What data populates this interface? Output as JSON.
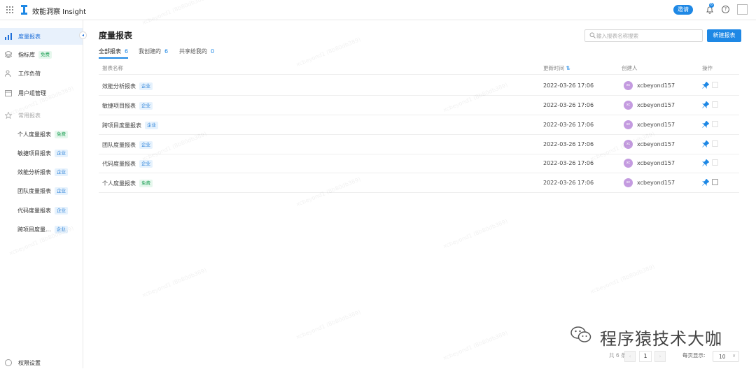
{
  "app": {
    "title": "效能洞察 Insight"
  },
  "header": {
    "invite_label": "邀请",
    "notif_count": "6",
    "help_glyph": "?"
  },
  "sidebar": {
    "items": [
      {
        "label": "度量报表",
        "icon": "bar-chart-icon"
      },
      {
        "label": "指标库",
        "icon": "layers-icon",
        "tag": "免费"
      },
      {
        "label": "工作负荷",
        "icon": "user-group-icon"
      },
      {
        "label": "用户组管理",
        "icon": "calendar-icon"
      },
      {
        "label": "常用报表",
        "icon": "star-icon"
      }
    ],
    "favorites": [
      {
        "label": "个人度量报表",
        "tag": "免费"
      },
      {
        "label": "敏捷项目报表",
        "tag": "企业"
      },
      {
        "label": "效能分析报表",
        "tag": "企业"
      },
      {
        "label": "团队度量报表",
        "tag": "企业"
      },
      {
        "label": "代码度量报表",
        "tag": "企业"
      },
      {
        "label": "跨项目度量...",
        "tag": "企业"
      }
    ],
    "bottom_label": "权限设置"
  },
  "main": {
    "title": "度量报表",
    "search_placeholder": "输入报表名称搜索",
    "new_button": "新建报表",
    "tabs": [
      {
        "label": "全部报表",
        "count": "6"
      },
      {
        "label": "我创建的",
        "count": "6"
      },
      {
        "label": "共享给我的",
        "count": "0"
      }
    ]
  },
  "table": {
    "headers": {
      "name": "报表名称",
      "updated": "更新时间",
      "creator": "创建人",
      "ops": "操作"
    },
    "rows": [
      {
        "name": "效能分析报表",
        "tag": "企业",
        "updated": "2022-03-26 17:06",
        "avatar": "xc",
        "creator": "xcbeyond157"
      },
      {
        "name": "敏捷项目报表",
        "tag": "企业",
        "updated": "2022-03-26 17:06",
        "avatar": "xc",
        "creator": "xcbeyond157"
      },
      {
        "name": "跨项目度量报表",
        "tag": "企业",
        "updated": "2022-03-26 17:06",
        "avatar": "xc",
        "creator": "xcbeyond157"
      },
      {
        "name": "团队度量报表",
        "tag": "企业",
        "updated": "2022-03-26 17:06",
        "avatar": "xc",
        "creator": "xcbeyond157"
      },
      {
        "name": "代码度量报表",
        "tag": "企业",
        "updated": "2022-03-26 17:06",
        "avatar": "xc",
        "creator": "xcbeyond157"
      },
      {
        "name": "个人度量报表",
        "tag": "免费",
        "updated": "2022-03-26 17:06",
        "avatar": "xc",
        "creator": "xcbeyond157"
      }
    ]
  },
  "pagination": {
    "total_text": "共 6 条",
    "current_page": "1",
    "page_size_label": "每页显示:",
    "page_size": "10",
    "prev_glyph": "‹",
    "next_glyph": "›",
    "dropdown_glyph": "∨"
  },
  "watermark_text": "xcbeyond1 (8b80db389)",
  "footer_brand": "程序猿技术大咖",
  "colors": {
    "accent": "#1e88e5",
    "active_bg": "#e8f1fc",
    "avatar": "#c49be0"
  }
}
